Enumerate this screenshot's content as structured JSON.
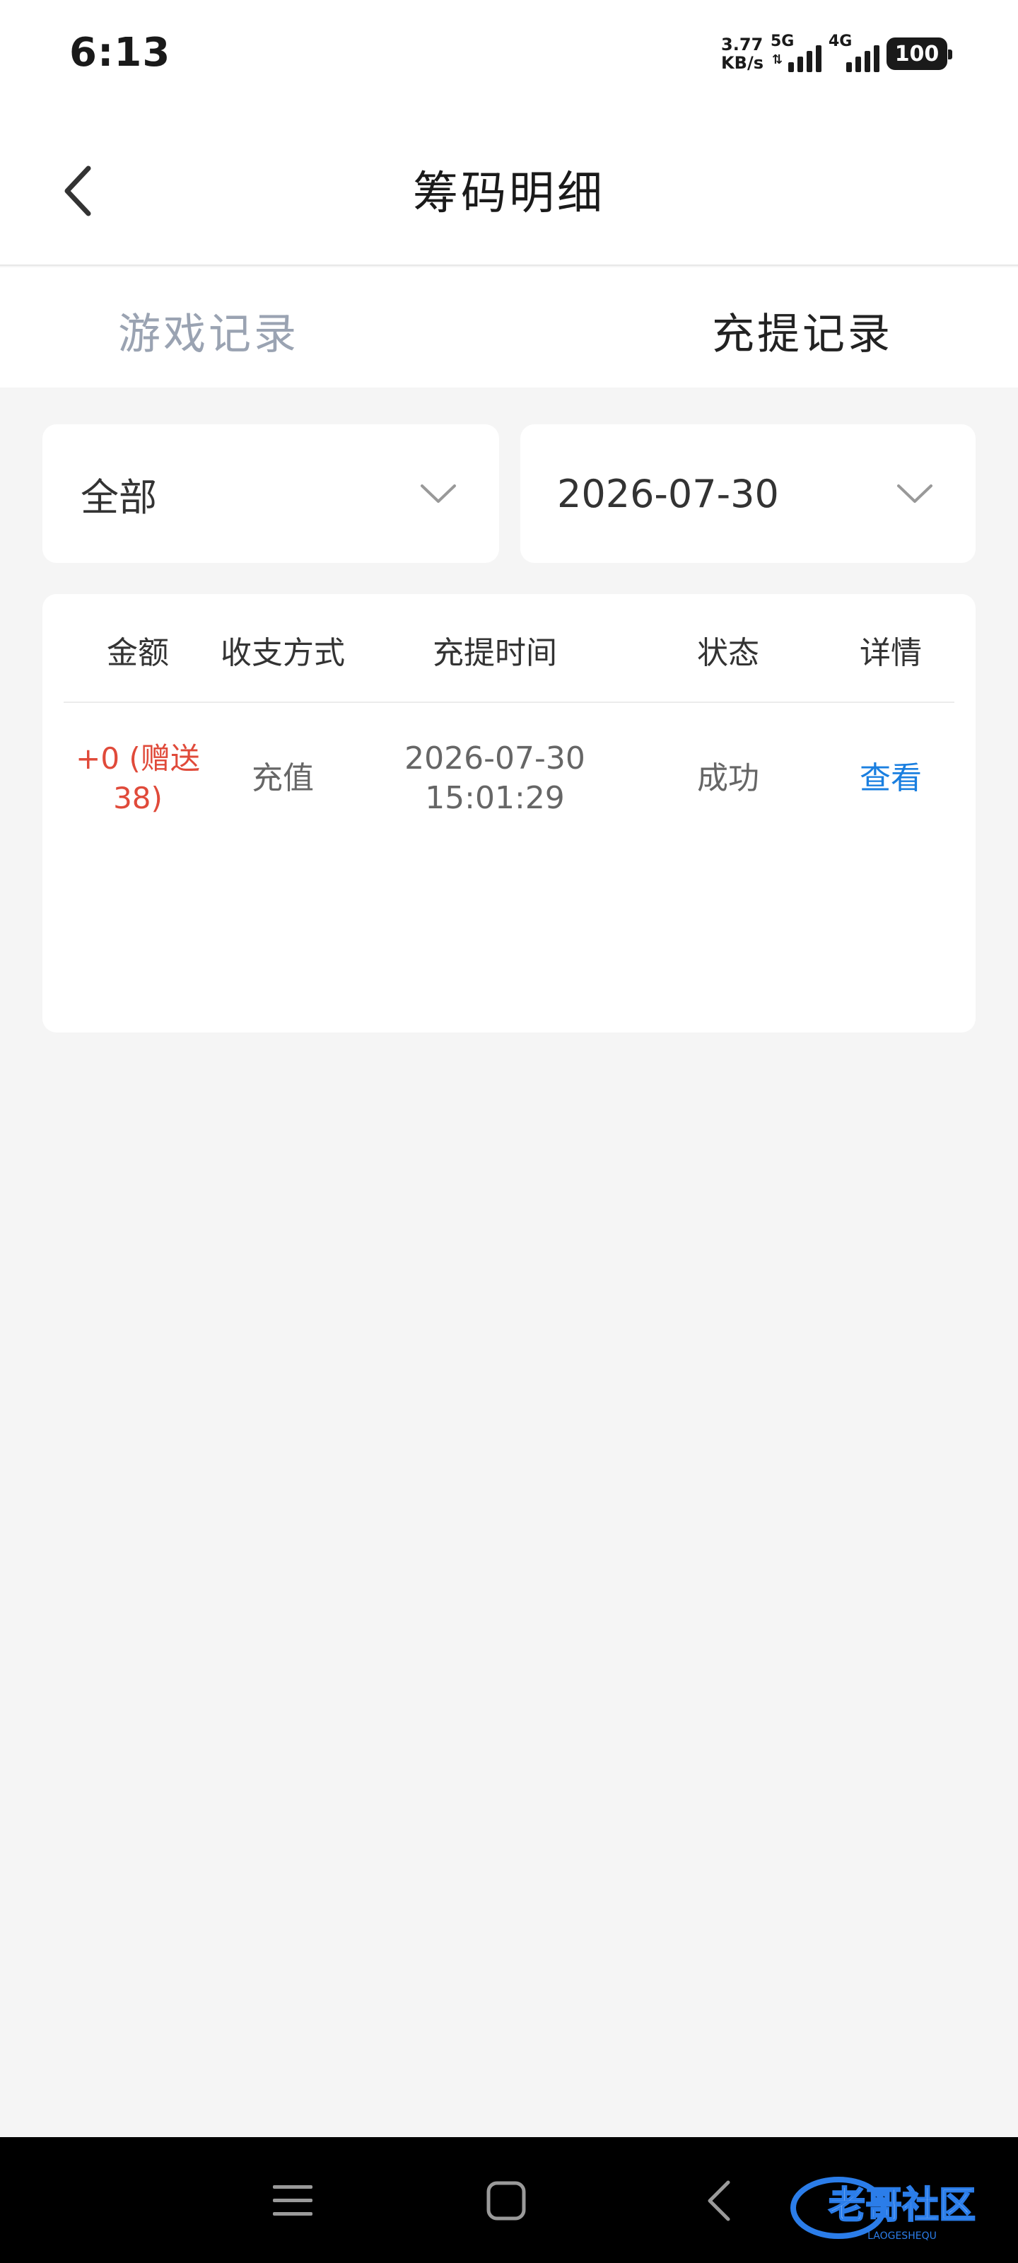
{
  "status_bar": {
    "time": "6:13",
    "net_speed_value": "3.77",
    "net_speed_unit": "KB/s",
    "signal1_label": "5G",
    "signal2_label": "4G",
    "battery": "100"
  },
  "header": {
    "title": "筹码明细",
    "back_icon": "chevron-left-icon"
  },
  "tabs": [
    {
      "label": "游戏记录",
      "active": false
    },
    {
      "label": "充提记录",
      "active": true
    }
  ],
  "filters": {
    "type_value": "全部",
    "date_value": "2026-07-30"
  },
  "table": {
    "columns": [
      "金额",
      "收支方式",
      "充提时间",
      "状态",
      "详情"
    ],
    "rows": [
      {
        "amount_line1": "+0 (赠送",
        "amount_line2": "38)",
        "method": "充值",
        "date": "2026-07-30",
        "time": "15:01:29",
        "status": "成功",
        "detail_link": "查看"
      }
    ]
  },
  "colors": {
    "background": "#f5f5f5",
    "amount_red": "#e04a3a",
    "link_blue": "#1a7fe0",
    "tab_inactive": "#9aa3b2"
  },
  "nav_bar": {
    "buttons": [
      "menu-icon",
      "home-square-icon",
      "back-chevron-icon"
    ],
    "watermark": "老哥社区",
    "watermark_sub": "LAOGESHEQU"
  }
}
